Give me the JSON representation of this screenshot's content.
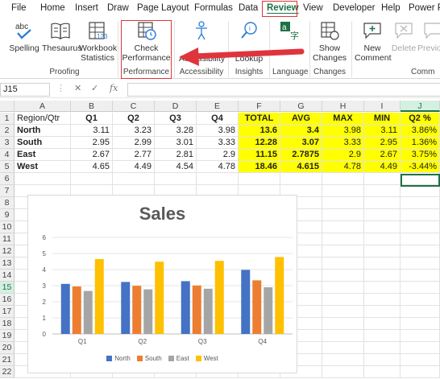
{
  "ribbon_tabs": [
    "File",
    "Home",
    "Insert",
    "Draw",
    "Page Layout",
    "Formulas",
    "Data",
    "Review",
    "View",
    "Developer",
    "Help",
    "Power Pi"
  ],
  "active_tab": "Review",
  "ribbon": {
    "spelling": "Spelling",
    "thesaurus": "Thesaurus",
    "workbook_stats_1": "Workbook",
    "workbook_stats_2": "Statistics",
    "proofing_group": "Proofing",
    "check_perf_1": "Check",
    "check_perf_2": "Performance",
    "performance_group": "Performance",
    "accessibility_label": "Accessibility",
    "accessibility_group": "Accessibility",
    "lookup_label": "Lookup",
    "insights_group": "Insights",
    "language_group": "Language",
    "show_changes_1": "Show",
    "show_changes_2": "Changes",
    "changes_group": "Changes",
    "new_comment_1": "New",
    "new_comment_2": "Comment",
    "delete_label": "Delete",
    "previous_label": "Previo",
    "comments_group": "Comm"
  },
  "formula_bar": {
    "name_box": "J15",
    "cancel": "✕",
    "enter": "✓",
    "fx": "fx",
    "value": ""
  },
  "columns": [
    "A",
    "B",
    "C",
    "D",
    "E",
    "F",
    "G",
    "H",
    "I",
    "J"
  ],
  "selected_column": "J",
  "rows": [
    "1",
    "2",
    "3",
    "4",
    "5",
    "6",
    "7",
    "8",
    "9",
    "10",
    "11",
    "12",
    "13",
    "14",
    "15",
    "16",
    "17",
    "18",
    "19",
    "20",
    "21",
    "22"
  ],
  "selected_row": "15",
  "table": {
    "header": [
      "Region/Qtr",
      "Q1",
      "Q2",
      "Q3",
      "Q4",
      "TOTAL",
      "AVG",
      "MAX",
      "MIN",
      "Q2 %"
    ],
    "data": [
      [
        "North",
        "3.11",
        "3.23",
        "3.28",
        "3.98",
        "13.6",
        "3.4",
        "3.98",
        "3.11",
        "3.86%"
      ],
      [
        "South",
        "2.95",
        "2.99",
        "3.01",
        "3.33",
        "12.28",
        "3.07",
        "3.33",
        "2.95",
        "1.36%"
      ],
      [
        "East",
        "2.67",
        "2.77",
        "2.81",
        "2.9",
        "11.15",
        "2.7875",
        "2.9",
        "2.67",
        "3.75%"
      ],
      [
        "West",
        "4.65",
        "4.49",
        "4.54",
        "4.78",
        "18.46",
        "4.615",
        "4.78",
        "4.49",
        "-3.44%"
      ]
    ]
  },
  "colors": {
    "north": "#4472c4",
    "south": "#ed7d31",
    "east": "#a5a5a5",
    "west": "#ffc000",
    "highlight": "#ffff00",
    "accent": "#1e7145",
    "annotation": "#e0343c"
  },
  "chart_data": {
    "type": "bar",
    "title": "Sales",
    "categories": [
      "Q1",
      "Q2",
      "Q3",
      "Q4"
    ],
    "series": [
      {
        "name": "North",
        "values": [
          3.11,
          3.23,
          3.28,
          3.98
        ]
      },
      {
        "name": "South",
        "values": [
          2.95,
          2.99,
          3.01,
          3.33
        ]
      },
      {
        "name": "East",
        "values": [
          2.67,
          2.77,
          2.81,
          2.9
        ]
      },
      {
        "name": "West",
        "values": [
          4.65,
          4.49,
          4.54,
          4.78
        ]
      }
    ],
    "ylim": [
      0,
      6
    ],
    "yticks": [
      "0",
      "1",
      "2",
      "3",
      "4",
      "5",
      "6"
    ],
    "grid": true,
    "legend": "bottom"
  }
}
